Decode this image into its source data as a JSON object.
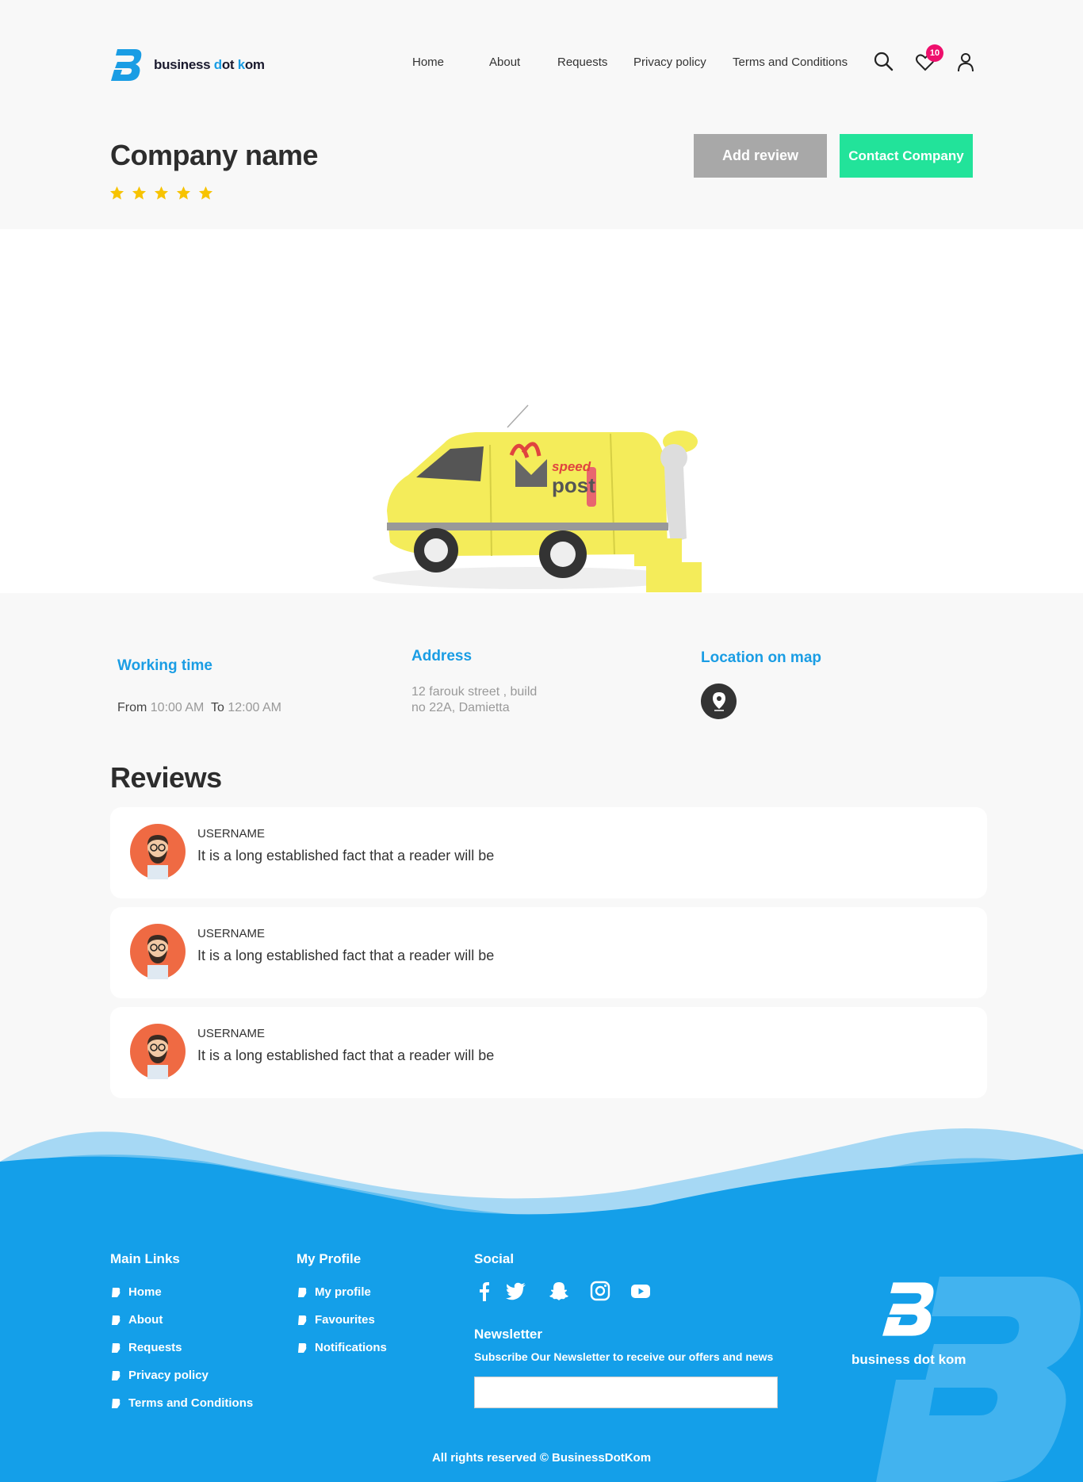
{
  "brand": {
    "name_part1": "business ",
    "name_hl1": "d",
    "name_part2": "ot ",
    "name_hl2": "k",
    "name_part3": "om",
    "accent": "#1a9de4"
  },
  "nav": {
    "items": [
      {
        "label": "Home"
      },
      {
        "label": "About"
      },
      {
        "label": "Requests"
      },
      {
        "label": "Privacy policy"
      },
      {
        "label": "Terms and Conditions"
      }
    ],
    "favourites_count": "10"
  },
  "company": {
    "name": "Company name",
    "rating": 5,
    "add_review_label": "Add review",
    "contact_label": "Contact Company"
  },
  "hero": {
    "van_brand_small": "speed",
    "van_brand_big": "post"
  },
  "info": {
    "working_time_title": "Working time",
    "from_label": "From",
    "from_value": "10:00 AM",
    "to_label": "To",
    "to_value": "12:00 AM",
    "address_title": "Address",
    "address_line1": "12 farouk street , build",
    "address_line2": "no 22A, Damietta",
    "map_title": "Location on map"
  },
  "reviews": {
    "title": "Reviews",
    "items": [
      {
        "username": "USERNAME",
        "text": "It is a long established fact that a reader will be"
      },
      {
        "username": "USERNAME",
        "text": "It is a long established fact that a reader will be"
      },
      {
        "username": "USERNAME",
        "text": "It is a long established fact that a reader will be"
      }
    ]
  },
  "footer": {
    "main_links_title": "Main Links",
    "main_links": [
      "Home",
      "About",
      "Requests",
      "Privacy policy",
      "Terms and Conditions"
    ],
    "profile_title": "My Profile",
    "profile_links": [
      "My profile",
      "Favourites",
      "Notifications"
    ],
    "social_title": "Social",
    "social_icons": [
      "facebook-icon",
      "twitter-icon",
      "snapchat-icon",
      "instagram-icon",
      "youtube-icon"
    ],
    "newsletter_title": "Newsletter",
    "newsletter_subtitle": "Subscribe Our Newsletter to receive our offers and news",
    "logo_text": "business dot kom",
    "copyright": "All rights reserved © BusinessDotKom",
    "background": "#149fe9"
  }
}
